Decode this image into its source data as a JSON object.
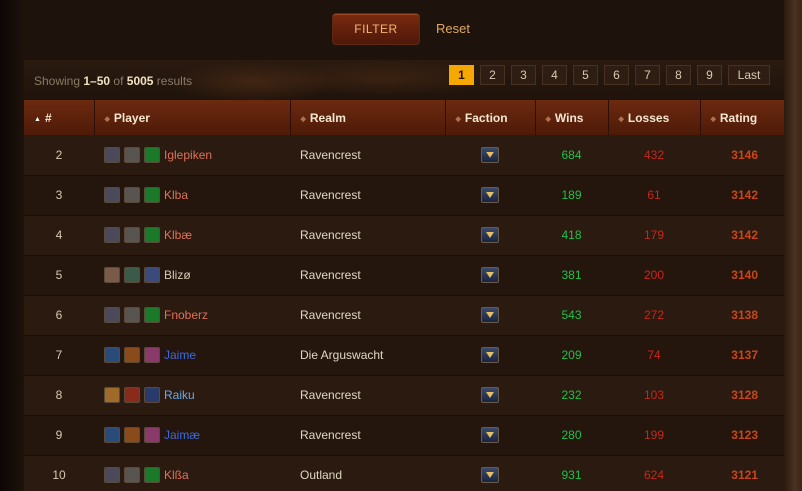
{
  "filter": {
    "button_label": "FILTER",
    "reset_label": "Reset"
  },
  "summary": {
    "prefix": "Showing ",
    "range": "1–50",
    "of": " of ",
    "total": "5005",
    "suffix": " results"
  },
  "pagination": {
    "pages": [
      "1",
      "2",
      "3",
      "4",
      "5",
      "6",
      "7",
      "8",
      "9"
    ],
    "active": "1",
    "last_label": "Last"
  },
  "table": {
    "columns": {
      "rank": "#",
      "player": "Player",
      "realm": "Realm",
      "faction": "Faction",
      "wins": "Wins",
      "losses": "Losses",
      "rating": "Rating"
    },
    "rows": [
      {
        "rank": "2",
        "player": "Iglepiken",
        "realm": "Ravencrest",
        "wins": "684",
        "losses": "432",
        "rating": "3146",
        "name_color": "#e0705a",
        "icons": [
          "#4a4a5a",
          "#5a5450",
          "#1a7a2a"
        ]
      },
      {
        "rank": "3",
        "player": "Klba",
        "realm": "Ravencrest",
        "wins": "189",
        "losses": "61",
        "rating": "3142",
        "name_color": "#e0705a",
        "icons": [
          "#4a4a5a",
          "#5a5450",
          "#1a7a2a"
        ]
      },
      {
        "rank": "4",
        "player": "Klbæ",
        "realm": "Ravencrest",
        "wins": "418",
        "losses": "179",
        "rating": "3142",
        "name_color": "#e0705a",
        "icons": [
          "#4a4a5a",
          "#5a5450",
          "#1a7a2a"
        ]
      },
      {
        "rank": "5",
        "player": "Blizø",
        "realm": "Ravencrest",
        "wins": "381",
        "losses": "200",
        "rating": "3140",
        "name_color": "#d8c9b4",
        "icons": [
          "#7a5a4a",
          "#3a5a4a",
          "#3a4a7a"
        ]
      },
      {
        "rank": "6",
        "player": "Fnoberz",
        "realm": "Ravencrest",
        "wins": "543",
        "losses": "272",
        "rating": "3138",
        "name_color": "#e0705a",
        "icons": [
          "#4a4a5a",
          "#5a5450",
          "#1a7a2a"
        ]
      },
      {
        "rank": "7",
        "player": "Jaime",
        "realm": "Die Arguswacht",
        "wins": "209",
        "losses": "74",
        "rating": "3137",
        "name_color": "#3a6ae0",
        "icons": [
          "#2a4a7a",
          "#8a4a1a",
          "#8a3a6a"
        ]
      },
      {
        "rank": "8",
        "player": "Raiku",
        "realm": "Ravencrest",
        "wins": "232",
        "losses": "103",
        "rating": "3128",
        "name_color": "#6aaae8",
        "icons": [
          "#a06a2a",
          "#8a2a1a",
          "#2a3a6a"
        ]
      },
      {
        "rank": "9",
        "player": "Jaimæ",
        "realm": "Ravencrest",
        "wins": "280",
        "losses": "199",
        "rating": "3123",
        "name_color": "#3a6ae0",
        "icons": [
          "#2a4a7a",
          "#8a4a1a",
          "#8a3a6a"
        ]
      },
      {
        "rank": "10",
        "player": "Klßa",
        "realm": "Outland",
        "wins": "931",
        "losses": "624",
        "rating": "3121",
        "name_color": "#e0705a",
        "icons": [
          "#4a4a5a",
          "#5a5450",
          "#1a7a2a"
        ]
      }
    ]
  }
}
